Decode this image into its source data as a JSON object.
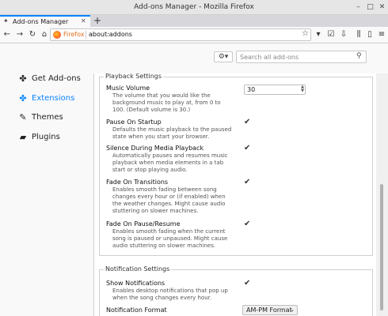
{
  "window": {
    "title": "Add-ons Manager - Mozilla Firefox"
  },
  "tab": {
    "label": "Add-ons Manager",
    "close": "✕"
  },
  "newtab": "+",
  "navbar": {
    "identity_label": "Firefox",
    "url": "about:addons"
  },
  "toolbar": {
    "search_placeholder": "Search all add-ons",
    "gear": "⚙▾"
  },
  "sidebar": {
    "items": [
      {
        "label": "Get Add-ons",
        "icon": "puzzle-icon"
      },
      {
        "label": "Extensions",
        "icon": "puzzle-icon",
        "active": true
      },
      {
        "label": "Themes",
        "icon": "brush-icon"
      },
      {
        "label": "Plugins",
        "icon": "plugin-icon"
      }
    ]
  },
  "playback": {
    "legend": "Playback Settings",
    "volume_title": "Music Volume",
    "volume_desc": "The volume that you would like the background music to play at, from 0 to 100. (Default volume is 30.)",
    "volume_value": "30",
    "pause_title": "Pause On Startup",
    "pause_desc": "Defaults the music playback to the paused state when you start your browser.",
    "pause_checked": true,
    "silence_title": "Silence During Media Playback",
    "silence_desc": "Automatically pauses and resumes music playback when media elements in a tab start or stop playing audio.",
    "silence_checked": true,
    "fade_title": "Fade On Transitions",
    "fade_desc": "Enables smooth fading between song changes every hour or (if enabled) when the weather changes. Might cause audio stuttering on slower machines.",
    "fade_checked": true,
    "fadepause_title": "Fade On Pause/Resume",
    "fadepause_desc": "Enables smooth fading when the current song is paused or unpaused. Might cause audio stuttering on slower machines.",
    "fadepause_checked": true
  },
  "notification": {
    "legend": "Notification Settings",
    "show_title": "Show Notifications",
    "show_desc": "Enables desktop notifications that pop up when the song changes every hour.",
    "show_checked": true,
    "format_title": "Notification Format",
    "format_value": "AM-PM Format"
  }
}
